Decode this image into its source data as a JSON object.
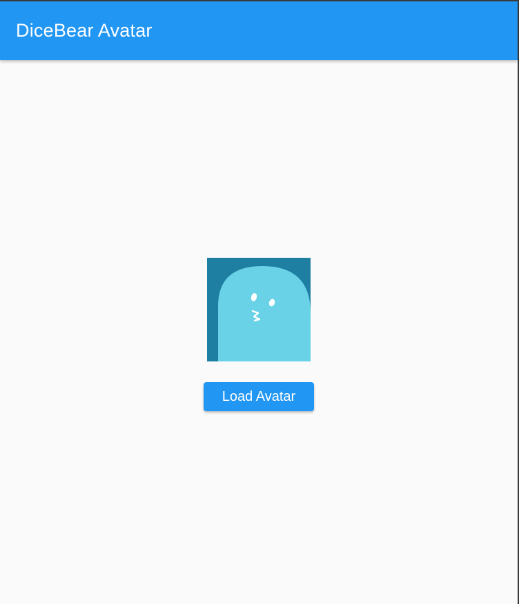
{
  "app_bar": {
    "title": "DiceBear Avatar"
  },
  "main": {
    "avatar": {
      "icon": "ghost-avatar-icon",
      "background_color": "#1e7fa3",
      "body_color": "#69d2e7"
    },
    "load_button_label": "Load Avatar"
  },
  "colors": {
    "primary": "#2196f3",
    "page_background": "#fafafa"
  }
}
